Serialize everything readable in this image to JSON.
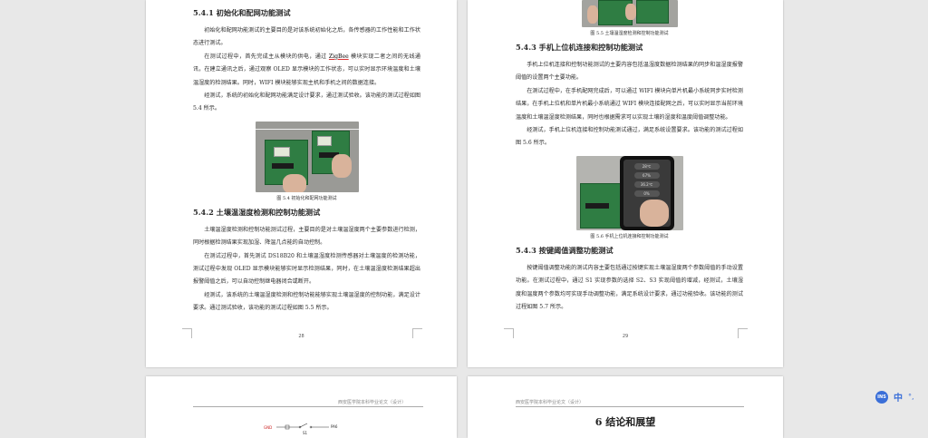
{
  "left_page": {
    "s541": {
      "title": "5.4.1 初始化和配网功能测试",
      "p1": "初始化和配网功能测试的主要目的是对该系统初始化之后，各传感器的工作性能和工作状态进行测试。",
      "p2_a": "在测试过程中，首先完成主从模块的供电，通过 ",
      "p2_zb": "ZigBee",
      "p2_b": " 模块实现二者之间的无线通讯，在建立通讯之后，通过观察 OLED 显示模块的工作状态，可以实时显示环境温度和土壤温湿度的检测结果。同时，WIFI 模块能够实现主机和手机之间的数据连接。",
      "p3": "经测试，系统的初始化和配网功能满足设计要求，通过测试验收。该功能的测试过程如图 5.4 所示。",
      "caption": "图 5.4 初始化和配网功能测试"
    },
    "s542": {
      "title": "5.4.2 土壤温湿度检测和控制功能测试",
      "p1": "土壤温湿度检测和控制功能测试过程，主要目的是对土壤温湿度两个主要参数进行检测，同时根据检测结果实现加湿、降温几点能的自动控制。",
      "p2": "在测试过程中，首先测试 DS18B20 和土壤温湿度检测传感器对土壤温度的检测功能，测试过程中发现 OLED 显示模块能够实时显示检测结果，同时，在土壤温湿度检测结果超出报警阈值之后，可以自动控制继电器闭合或断开。",
      "p3": "经测试，该系统的土壤温湿度检测和控制功能能够实现土壤温湿度的控制功能，满足设计要求。通过测试验收，该功能的测试过程如图 5.5 所示。"
    },
    "page_number": "28"
  },
  "right_page": {
    "fig53_caption": "图 5.5 土壤温湿度检测和控制功能测试",
    "s543": {
      "title": "5.4.3 手机上位机连接和控制功能测试",
      "p1": "手机上位机连接和控制功能测试的主要内容包括温湿度数据检测结果的同步和温湿度报警阈值的设置两个主要功能。",
      "p2": "在测试过程中，在手机配网完成后，可以通过 WIFI 模块向单片机最小系统同步实时检测结果，在手机上位机和单片机最小系统通过 WIFI 模块连接配网之后，可以实时显示当前环境温度和土壤温湿度检测结果，同时也根据需求可以实现土壤的湿度和温度阈值调整功能。",
      "p3": "经测试，手机上位机连接和控制功能测试通过，满足系统设置要求。该功能的测试过程如图 5.6 所示。",
      "caption": "图 5.6 手机上位机连接和控制功能测试"
    },
    "phone": {
      "r1": "28℃",
      "r2": "67%",
      "r3": "36.2℃",
      "r4": "0%"
    },
    "s544": {
      "title": "5.4.3 按键阈值调整功能测试",
      "p1": "按键阈值调整功能的测试内容主要包括通过按键实现土壤温湿度两个参数阈值的手动设置功能。在测试过程中，通过 S1 实现参数的选择 S2、S3 实现阈值的增减，经测试，土壤湿度和温度两个参数均可实现手动调整功能，满足系统设计要求，通过功能验收。该功能的测试过程如图 5.7 所示。"
    },
    "page_number": "29"
  },
  "left_page2": {
    "header": "西安医学院本科毕业论文（设计）",
    "circuit_gnd": "GND",
    "circuit_s1": "S1",
    "circuit_pin": "PA6"
  },
  "right_page2": {
    "header": "西安医学院本科毕业论文（设计）",
    "chapter": "6  结论和展望"
  },
  "toolbar": {
    "badge": "INS",
    "lang": "中",
    "dots": "°,"
  }
}
